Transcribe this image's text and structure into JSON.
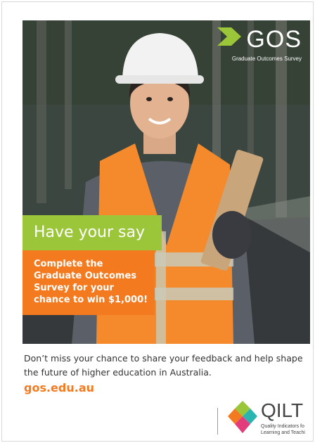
{
  "logo": {
    "name": "GOS",
    "tagline": "Graduate Outcomes Survey"
  },
  "headline": "Have your say",
  "promo": {
    "lines": [
      "Complete the",
      "Graduate Outcomes",
      "Survey for your",
      "chance to win $1,000!"
    ]
  },
  "body_text": "Don’t miss your chance to share your feedback and help shape the future of higher education in Australia.",
  "website": "gos.edu.au",
  "footer_logo": {
    "name": "QILT",
    "subtitle_line1": "Quality Indicators fo",
    "subtitle_line2": "Learning and Teachi"
  },
  "colors": {
    "orange": "#f47a20",
    "green": "#9cc63a",
    "text": "#333333"
  },
  "icons": [
    "gos-chevron-icon",
    "qilt-diamond-icon"
  ]
}
